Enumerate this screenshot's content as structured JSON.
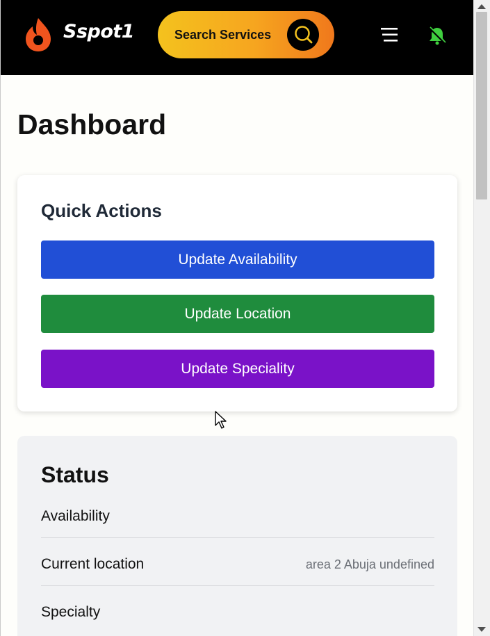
{
  "header": {
    "brand": "Sspot1",
    "search_label": "Search Services",
    "icons": [
      "flame-logo-icon",
      "search-icon",
      "hamburger-menu-icon",
      "bell-off-icon"
    ]
  },
  "main": {
    "title": "Dashboard"
  },
  "quick_actions": {
    "title": "Quick Actions",
    "buttons": [
      {
        "label": "Update Availability",
        "color": "#214fd6"
      },
      {
        "label": "Update Location",
        "color": "#1f8c3d"
      },
      {
        "label": "Update Speciality",
        "color": "#7a12c8"
      }
    ]
  },
  "status": {
    "title": "Status",
    "rows": [
      {
        "label": "Availability",
        "value": ""
      },
      {
        "label": "Current location",
        "value": "area 2 Abuja undefined"
      },
      {
        "label": "Specialty",
        "value": ""
      }
    ]
  },
  "colors": {
    "header_bg": "#000000",
    "search_gradient_start": "#f4c21e",
    "search_gradient_end": "#f0781c",
    "logo_orange": "#f0541e",
    "bell_green": "#3fcf3f",
    "status_card_bg": "#f1f2f4"
  }
}
